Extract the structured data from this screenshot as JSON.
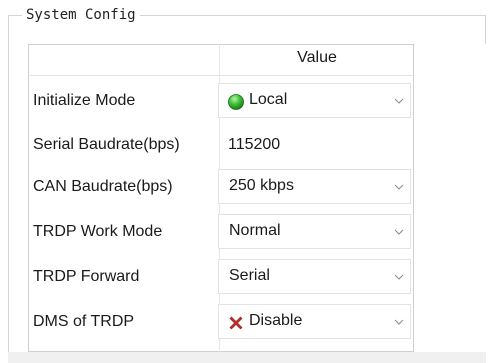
{
  "group": {
    "title": "System Config"
  },
  "table": {
    "header": "Value",
    "rows": [
      {
        "label": "Initialize Mode",
        "value": "Local",
        "icon": "green-circle-icon",
        "control": "dropdown"
      },
      {
        "label": "Serial Baudrate(bps)",
        "value": "115200",
        "control": "text"
      },
      {
        "label": "CAN Baudrate(bps)",
        "value": "250 kbps",
        "control": "dropdown"
      },
      {
        "label": "TRDP Work Mode",
        "value": "Normal",
        "control": "dropdown"
      },
      {
        "label": "TRDP Forward",
        "value": "Serial",
        "control": "dropdown"
      },
      {
        "label": "DMS of TRDP",
        "value": "Disable",
        "icon": "red-x-icon",
        "control": "dropdown"
      }
    ]
  },
  "colors": {
    "status_ok": "#2fb52f",
    "status_off": "#c9302c",
    "border": "#d5d5d5"
  }
}
